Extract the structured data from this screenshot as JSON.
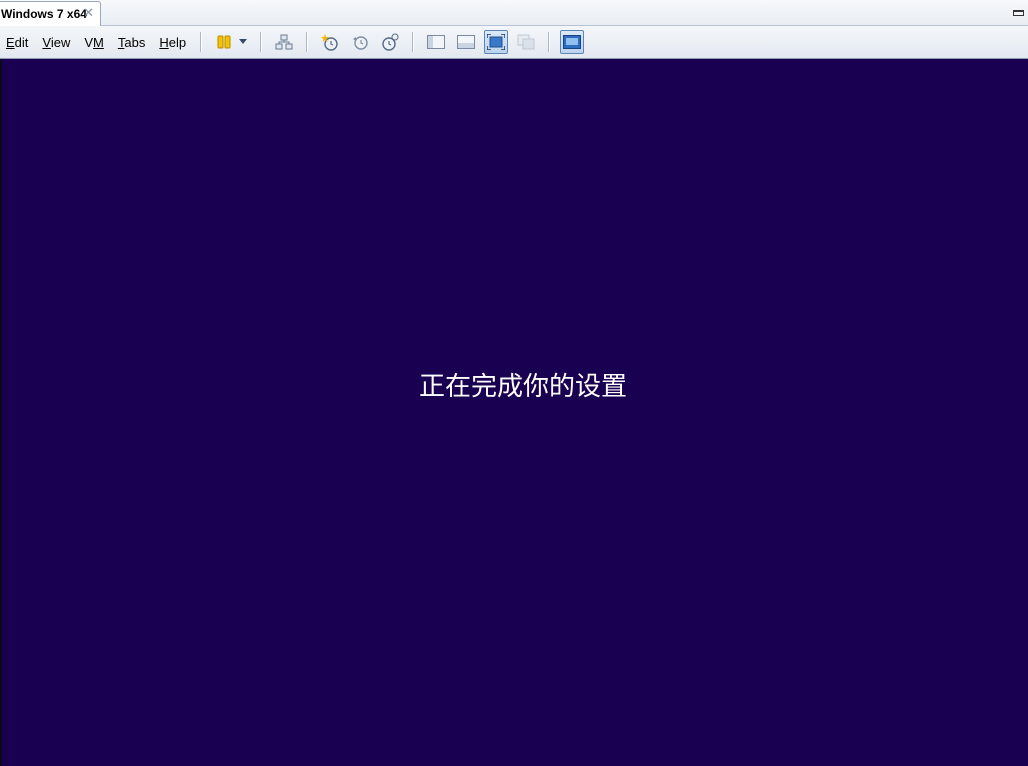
{
  "tabs": [
    {
      "label": "Windows 7 x64",
      "close": "✕"
    }
  ],
  "menu": {
    "edit": {
      "accel": "E",
      "rest": "dit"
    },
    "view": {
      "accel": "V",
      "rest": "iew"
    },
    "vm": {
      "pre": "V",
      "accel": "M",
      "rest": ""
    },
    "tabs": {
      "accel": "T",
      "rest": "abs"
    },
    "help": {
      "accel": "H",
      "rest": "elp"
    }
  },
  "toolbar": {
    "icons": [
      "suspend-icon",
      "dropdown-arrow-icon",
      "network-icon",
      "take-snapshot-icon",
      "revert-snapshot-icon",
      "snapshot-manager-icon",
      "show-library-icon",
      "thumbnail-bar-icon",
      "fullscreen-icon",
      "unity-icon",
      "console-view-icon"
    ],
    "accent": "#f5c400"
  },
  "vm_screen": {
    "background": "#190050",
    "message": "正在完成你的设置"
  }
}
